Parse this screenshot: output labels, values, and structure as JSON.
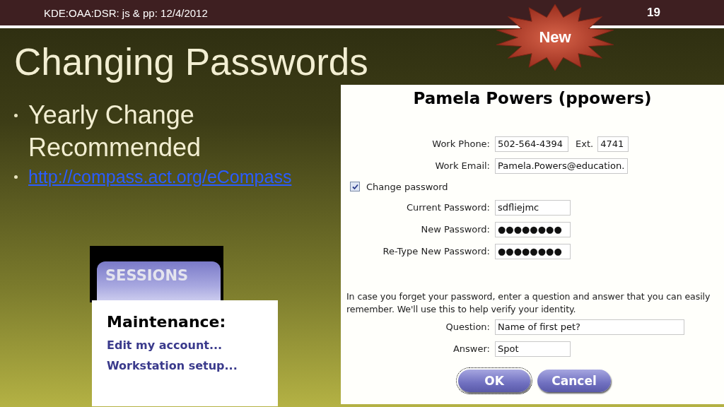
{
  "header": {
    "footer_text": "KDE:OAA:DSR: js & pp: 12/4/2012",
    "slide_number": "19"
  },
  "badge": {
    "label": "New"
  },
  "title": "Changing Passwords",
  "bullets": [
    {
      "kind": "text",
      "text": "Yearly Change Recommended"
    },
    {
      "kind": "link",
      "text": "http://compass.act.org/eCompass"
    }
  ],
  "sessions": {
    "tab": "SESSIONS",
    "heading": "Maintenance:",
    "links": [
      "Edit my account...",
      "Workstation setup..."
    ]
  },
  "form": {
    "title": "Pamela Powers (ppowers)",
    "rows": [
      {
        "kind": "phone",
        "label": "Work Phone:",
        "value": "502-564-4394",
        "ext_label": "Ext.",
        "ext_value": "4741"
      },
      {
        "kind": "text",
        "label": "Work Email:",
        "value": "Pamela.Powers@education."
      },
      {
        "kind": "checkbox",
        "label": "Change password",
        "checked": true
      },
      {
        "kind": "text",
        "label": "Current Password:",
        "value": "sdfliejmc"
      },
      {
        "kind": "text",
        "label": "New Password:",
        "value": "●●●●●●●●"
      },
      {
        "kind": "text",
        "label": "Re-Type New Password:",
        "value": "●●●●●●●●"
      }
    ],
    "note": "In case you forget your password, enter a question and answer that you can easily remember. We'll use this to help verify your identity.",
    "security": [
      {
        "kind": "wide",
        "label": "Question:",
        "value": "Name of first pet?"
      },
      {
        "kind": "text",
        "label": "Answer:",
        "value": "Spot"
      }
    ],
    "buttons": [
      {
        "label": "OK",
        "focused": true
      },
      {
        "label": "Cancel",
        "focused": false
      }
    ]
  }
}
